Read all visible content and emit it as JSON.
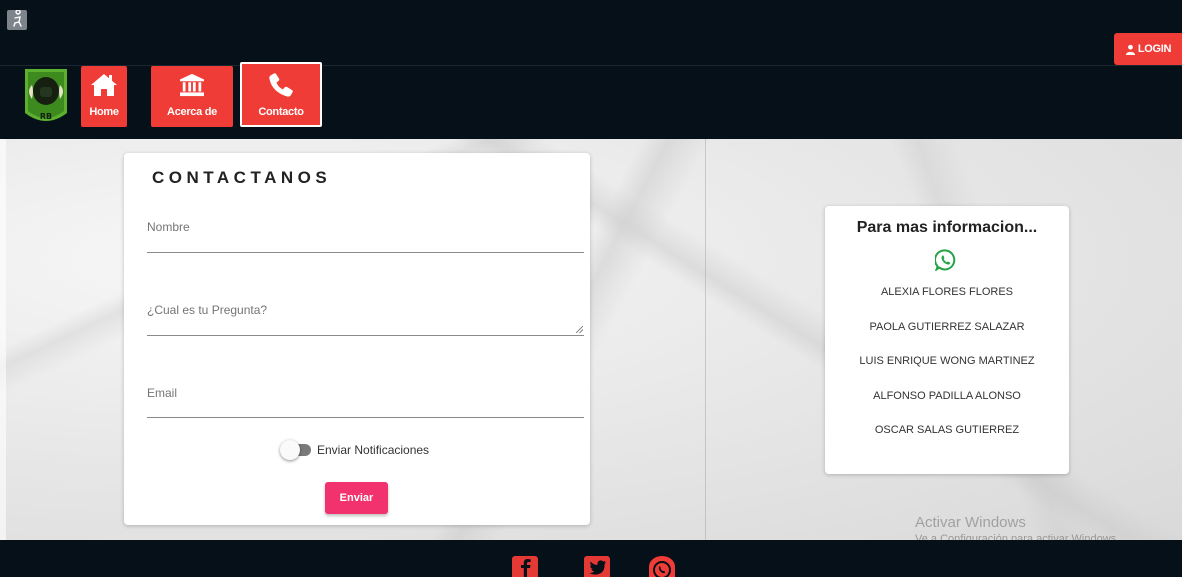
{
  "header": {
    "login_label": "LOGIN"
  },
  "nav": {
    "items": [
      {
        "label": "Home",
        "icon": "home-icon"
      },
      {
        "label": "Acerca de",
        "icon": "bank-icon"
      },
      {
        "label": "Contacto",
        "icon": "phone-icon"
      }
    ],
    "active": "Contacto"
  },
  "form": {
    "title": "CONTACTANOS",
    "nombre_placeholder": "Nombre",
    "pregunta_placeholder": "¿Cual es tu Pregunta?",
    "email_placeholder": "Email",
    "nombre_value": "",
    "pregunta_value": "",
    "email_value": "",
    "switch_label": "Enviar Notificaciones",
    "switch_on": false,
    "submit_label": "Enviar"
  },
  "info": {
    "title": "Para mas informacion...",
    "contacts": [
      "ALEXIA FLORES FLORES",
      "PAOLA GUTIERREZ SALAZAR",
      "LUIS ENRIQUE WONG MARTINEZ",
      "ALFONSO PADILLA ALONSO",
      "OSCAR SALAS GUTIERREZ"
    ]
  },
  "watermark": {
    "title": "Activar Windows",
    "subtitle": "Ve a Configuración para activar Windows."
  },
  "footer": {
    "social": [
      "facebook-icon",
      "twitter-icon",
      "whatsapp-icon"
    ]
  },
  "colors": {
    "background": "#061018",
    "nav_red": "#f03c36",
    "submit_pink": "#f2326e",
    "whatsapp_green": "#25a244"
  }
}
